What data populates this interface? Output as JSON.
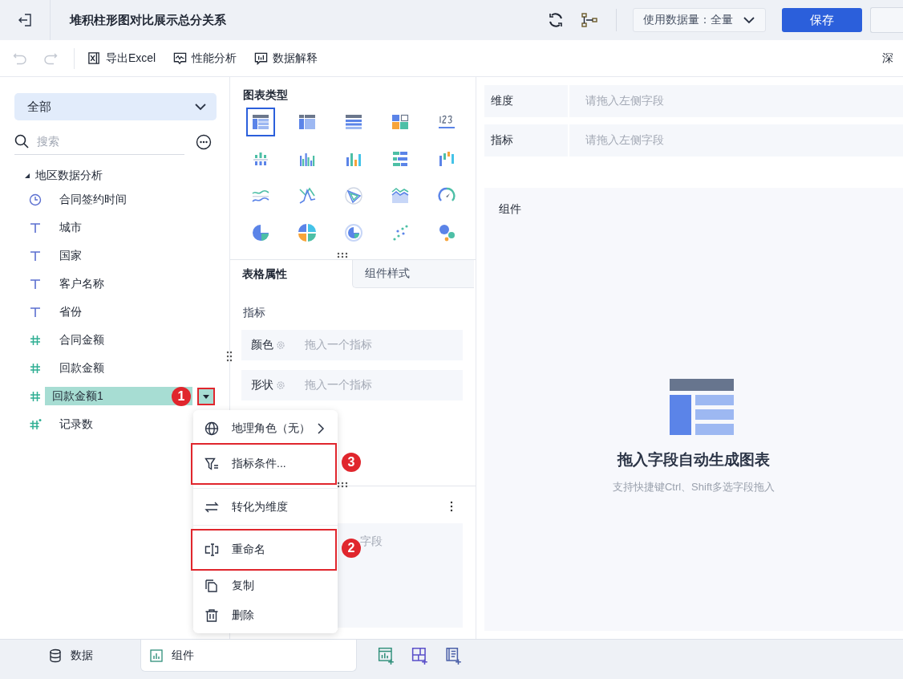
{
  "header": {
    "title": "堆积柱形图对比展示总分关系",
    "data_volume": "使用数据量：全量",
    "save": "保存"
  },
  "toolbar": {
    "undo_disabled": true,
    "redo_disabled": true,
    "items": [
      {
        "label": "导出Excel",
        "kind": "excel"
      },
      {
        "label": "性能分析",
        "kind": "perf"
      },
      {
        "label": "数据解释",
        "kind": "explain"
      }
    ],
    "theme": "深"
  },
  "sidebar": {
    "scope": "全部",
    "search_placeholder": "搜索",
    "group": {
      "label": "地区数据分析",
      "expanded": true,
      "children": [
        {
          "label": "合同签约时间",
          "kind": "date",
          "selected": false
        },
        {
          "label": "城市",
          "kind": "text",
          "selected": false
        },
        {
          "label": "国家",
          "kind": "text",
          "selected": false
        },
        {
          "label": "客户名称",
          "kind": "text",
          "selected": false
        },
        {
          "label": "省份",
          "kind": "text",
          "selected": false
        },
        {
          "label": "合同金额",
          "kind": "number",
          "selected": false
        },
        {
          "label": "回款金额",
          "kind": "number",
          "selected": false
        },
        {
          "label": "回款金额1",
          "kind": "number",
          "selected": true,
          "callout": "1"
        },
        {
          "label": "记录数",
          "kind": "count",
          "selected": false
        }
      ]
    }
  },
  "chart_types": {
    "title": "图表类型",
    "items": [
      {
        "kind": "cross-table",
        "selected": true
      },
      {
        "kind": "group-table",
        "selected": false
      },
      {
        "kind": "detail-table",
        "selected": false
      },
      {
        "kind": "kpi-grid",
        "selected": false
      },
      {
        "kind": "number",
        "selected": false
      },
      {
        "kind": "stacked-bar",
        "selected": false
      },
      {
        "kind": "grouped-bar",
        "selected": false
      },
      {
        "kind": "multi-bar",
        "selected": false
      },
      {
        "kind": "bar-rows",
        "selected": false
      },
      {
        "kind": "waterfall",
        "selected": false
      },
      {
        "kind": "line",
        "selected": false
      },
      {
        "kind": "polyline",
        "selected": false
      },
      {
        "kind": "radar",
        "selected": false
      },
      {
        "kind": "area",
        "selected": false
      },
      {
        "kind": "gauge",
        "selected": false
      },
      {
        "kind": "pie",
        "selected": false
      },
      {
        "kind": "pie-quad",
        "selected": false
      },
      {
        "kind": "ring",
        "selected": false
      },
      {
        "kind": "scatter",
        "selected": false
      },
      {
        "kind": "bubble",
        "selected": false
      }
    ]
  },
  "property_tabs": [
    {
      "label": "表格属性",
      "selected": true
    },
    {
      "label": "组件样式",
      "selected": false
    }
  ],
  "properties": {
    "section": "指标",
    "rows": [
      {
        "label": "颜色",
        "hint": "拖入一个指标"
      },
      {
        "label": "形状",
        "hint": "拖入一个指标"
      }
    ]
  },
  "lower_panel": {
    "hint": "字段"
  },
  "context_menu": {
    "items": [
      {
        "label": "地理角色（无）",
        "kind": "globe",
        "submenu": true,
        "highlighted": false
      },
      {
        "label": "指标条件...",
        "kind": "filter",
        "submenu": false,
        "highlighted": true,
        "callout": "3"
      },
      {
        "label": "转化为维度",
        "kind": "swap",
        "submenu": false,
        "highlighted": false
      },
      {
        "label": "重命名",
        "kind": "rename",
        "submenu": false,
        "highlighted": true,
        "callout": "2"
      },
      {
        "label": "复制",
        "kind": "copy",
        "submenu": false,
        "highlighted": false
      },
      {
        "label": "删除",
        "kind": "delete",
        "submenu": false,
        "highlighted": false
      }
    ]
  },
  "shelves": [
    {
      "label": "维度",
      "hint": "请拖入左侧字段"
    },
    {
      "label": "指标",
      "hint": "请拖入左侧字段"
    }
  ],
  "canvas": {
    "title": "组件",
    "empty_title": "拖入字段自动生成图表",
    "empty_hint": "支持快捷键Ctrl、Shift多选字段拖入"
  },
  "bottom_tabs": [
    {
      "label": "数据",
      "kind": "data",
      "selected": false
    },
    {
      "label": "组件",
      "kind": "component",
      "selected": true
    }
  ],
  "bottom_actions": [
    {
      "kind": "add-chart"
    },
    {
      "kind": "add-grid"
    },
    {
      "kind": "add-text"
    }
  ]
}
